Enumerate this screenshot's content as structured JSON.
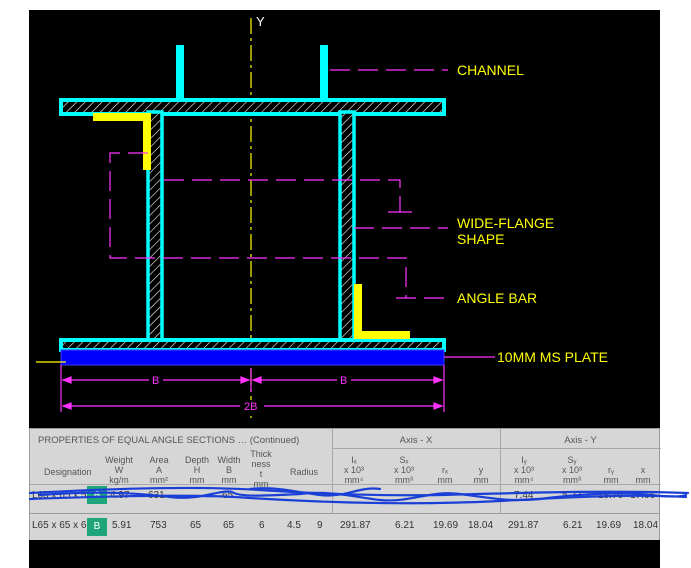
{
  "drawing": {
    "axis_label": "Y",
    "labels": {
      "channel": "CHANNEL",
      "wide_flange_line1": "WIDE-FLANGE",
      "wide_flange_line2": "SHAPE",
      "angle_bar": "ANGLE BAR",
      "plate": "10MM MS PLATE"
    },
    "dimensions": {
      "half_left": "B",
      "half_right": "B",
      "total": "2B"
    },
    "colors": {
      "background": "#000000",
      "section": "#00ffff",
      "angle": "#ffff00",
      "plate": "#0000ff",
      "dimension": "#ff33ff",
      "axis": "#ffff00"
    }
  },
  "table": {
    "title": "PROPERTIES OF EQUAL ANGLE SECTIONS … (Continued)",
    "axis_x": "Axis - X",
    "axis_y": "Axis - Y",
    "headers": {
      "designation": "Designation",
      "weight": [
        "Weight",
        "W",
        "kg/m"
      ],
      "area": [
        "Area",
        "A",
        "mm²"
      ],
      "depth": [
        "Depth",
        "H",
        "mm"
      ],
      "width": [
        "Width",
        "B",
        "mm"
      ],
      "thick": [
        "Thick",
        "ness",
        "t",
        "mm"
      ],
      "radius": "Radius",
      "ix": [
        "Iₓ",
        "x 10³",
        "mm⁴"
      ],
      "sx": [
        "Sₓ",
        "x 10³",
        "mm³"
      ],
      "rx": [
        "rₓ",
        "mm"
      ],
      "y": [
        "y",
        "mm"
      ],
      "iy": [
        "Iᵧ",
        "x 10³",
        "mm⁴"
      ],
      "sy": [
        "Sᵧ",
        "x 10³",
        "mm³"
      ],
      "ry": [
        "rᵧ",
        "mm"
      ],
      "x": [
        "x",
        "mm"
      ]
    },
    "row_a": {
      "designation": "L65 x 65 x 5",
      "badge": "A",
      "weight": "4.97",
      "area": "631",
      "depth": "65",
      "width": "65",
      "iy": "7.44",
      "sy": "5.22",
      "ry": "19.76",
      "x": "17.66"
    },
    "row_b": {
      "designation": "L65 x 65 x 6",
      "badge": "B",
      "weight": "5.91",
      "area": "753",
      "depth": "65",
      "width": "65",
      "thick": "6",
      "r1": "4.5",
      "r2": "9",
      "ix": "291.87",
      "sx": "6.21",
      "rx": "19.69",
      "y": "18.04",
      "iy": "291.87",
      "sy": "6.21",
      "ry": "19.69",
      "x": "18.04"
    },
    "scribble_color": "#1a3fd6"
  }
}
